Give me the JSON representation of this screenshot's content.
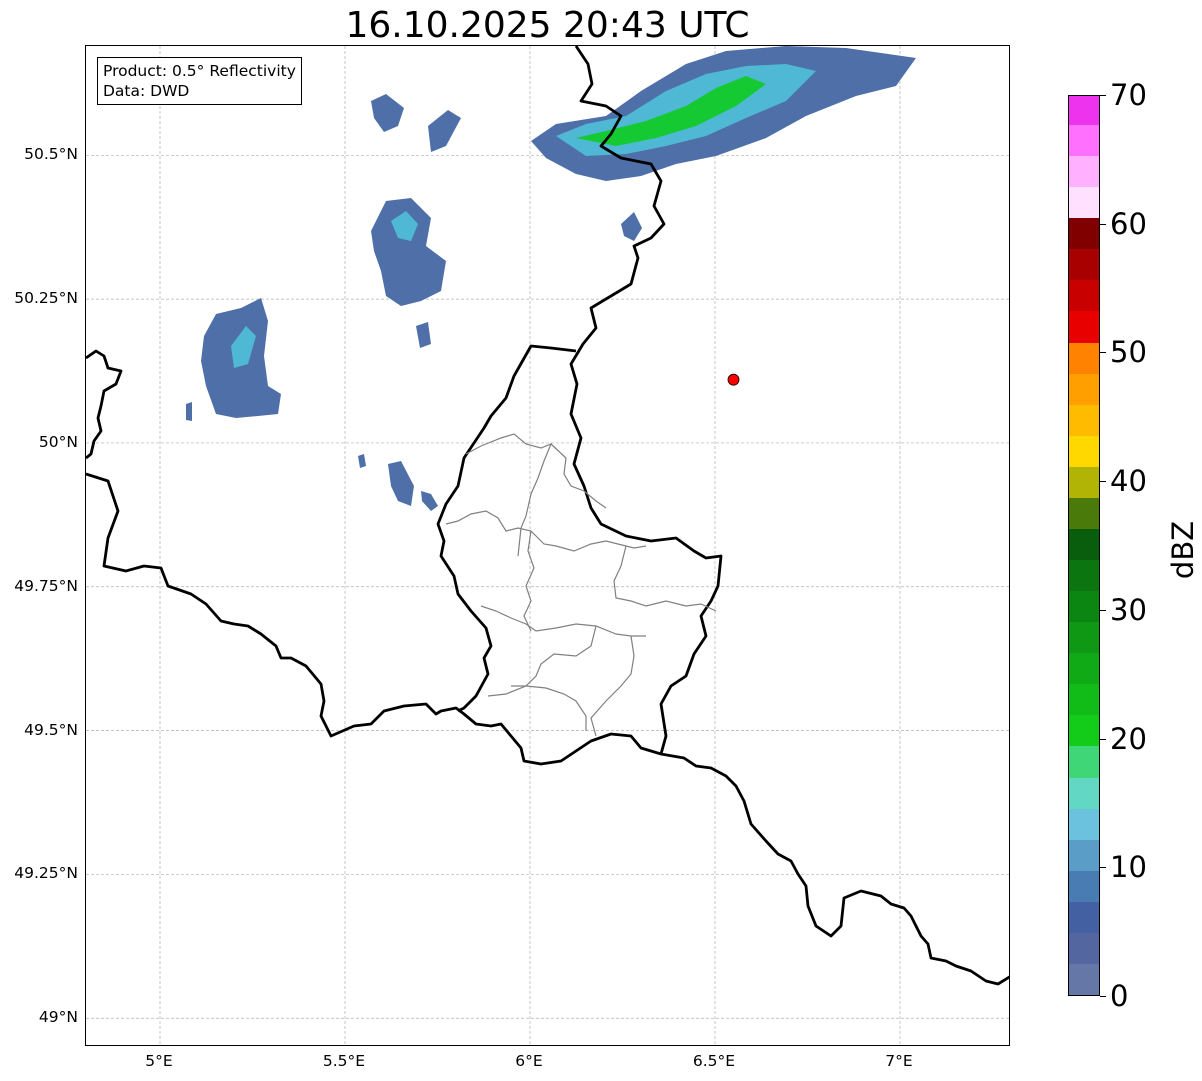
{
  "title": "16.10.2025 20:43 UTC",
  "info": {
    "product": "Product: 0.5° Reflectivity",
    "data": "Data: DWD"
  },
  "map_extent": {
    "lon_min": 4.8,
    "lon_max": 7.3,
    "lat_min": 48.95,
    "lat_max": 50.69
  },
  "lat_ticks": [
    {
      "value": 50.5,
      "label": "50.5°N"
    },
    {
      "value": 50.25,
      "label": "50.25°N"
    },
    {
      "value": 50.0,
      "label": "50°N"
    },
    {
      "value": 49.75,
      "label": "49.75°N"
    },
    {
      "value": 49.5,
      "label": "49.5°N"
    },
    {
      "value": 49.25,
      "label": "49.25°N"
    },
    {
      "value": 49.0,
      "label": "49°N"
    }
  ],
  "lon_ticks": [
    {
      "value": 5.0,
      "label": "5°E"
    },
    {
      "value": 5.5,
      "label": "5.5°E"
    },
    {
      "value": 6.0,
      "label": "6°E"
    },
    {
      "value": 6.5,
      "label": "6.5°E"
    },
    {
      "value": 7.0,
      "label": "7°E"
    }
  ],
  "radar_site": {
    "lon": 6.55,
    "lat": 50.11,
    "color": "#ff0000"
  },
  "colorbar": {
    "unit": "dBZ",
    "min": 0,
    "max": 70,
    "tick_labels": [
      "0",
      "10",
      "20",
      "30",
      "40",
      "50",
      "60",
      "70"
    ],
    "tick_values": [
      0,
      10,
      20,
      30,
      40,
      50,
      60,
      70
    ],
    "colors": [
      "#6577a6",
      "#5366a0",
      "#4360a3",
      "#4a7cb4",
      "#5a9dc6",
      "#6bc2de",
      "#62d7c3",
      "#3ed676",
      "#13cc1a",
      "#11bb18",
      "#10aa16",
      "#0e9814",
      "#0c8612",
      "#0b7510",
      "#085e0c",
      "#4a7a0a",
      "#b1b404",
      "#ffd800",
      "#ffbb00",
      "#ffa000",
      "#ff8200",
      "#e80000",
      "#c80000",
      "#a80000",
      "#800000",
      "#ffe0ff",
      "#ffb0ff",
      "#ff70ff",
      "#ee33ee"
    ]
  },
  "colors": {
    "precip_light": "#4f6fa8",
    "precip_mid": "#4fb8d4",
    "precip_heavy": "#15c932",
    "border": "#000000",
    "canton_border": "#808080",
    "grid": "#b0b0b0"
  }
}
